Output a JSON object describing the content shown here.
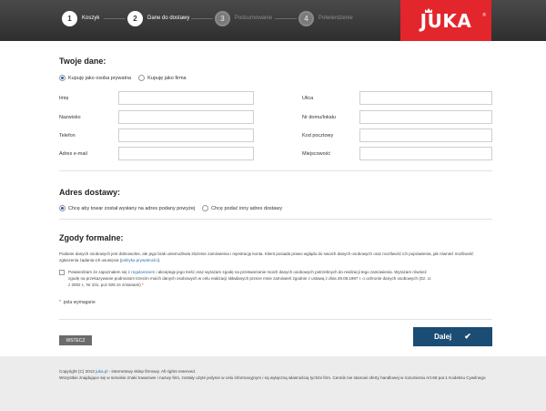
{
  "steps": [
    {
      "num": "1",
      "label": "Koszyk"
    },
    {
      "num": "2",
      "label": "Dane do dostawy"
    },
    {
      "num": "3",
      "label": "Podsumowanie"
    },
    {
      "num": "4",
      "label": "Potwierdzenie"
    }
  ],
  "logo": {
    "text": "JUKA",
    "reg": "®"
  },
  "personal": {
    "title": "Twoje dane:",
    "radio_private": "Kupuję jako osoba prywatna",
    "radio_company": "Kupuję jako firma",
    "fields_left": [
      "Imię",
      "Nazwisko",
      "Telefon",
      "Adres e-mail"
    ],
    "fields_right": [
      "Ulica",
      "Nr domu/lokalu",
      "Kod pocztowy",
      "Miejscowość"
    ]
  },
  "delivery": {
    "title": "Adres dostawy:",
    "radio_same": "Chcę aby towar został wysłany na adres podany powyżej",
    "radio_other": "Chcę podać inny adres dostawy"
  },
  "consents": {
    "title": "Zgody formalne:",
    "intro": "Podanie danych osobowych jest dobrowolne, ale jego brak uniemożliwia złożenie zamówienia i rejestrację konta. Klient posiada prawo wglądu do swoich danych osobowych oraz możliwość ich poprawienia, jak również możliwość zgłoszenia żądania ich usunięcia (",
    "intro_link": "polityka prywatności",
    "intro_end": ").",
    "check_text_1": "Potwierdzam że zapoznałem się z ",
    "check_link": "regulaminem",
    "check_text_2": " i akceptuję jego treść oraz wyrażam zgodę na przetwarzanie moich danych osobowych potrzebnych do realizacji tego zamówienia. Wyrażam również zgodę na przekazywanie podmiotom trzecim moich danych osobowych w celu realizacji składanych przeze mnie zamówień zgodnie z ustawą z dnia 29.08.1997 r. o ochronie danych osobowych (Dz. U. z 2002 r., Nr 101, poz 926 ze zmianami) ",
    "required_mark": "*",
    "required_note": "pola wymagane"
  },
  "buttons": {
    "back": "WSTECZ",
    "next": "Dalej",
    "next_icon": "✔"
  },
  "footer": {
    "line1_prefix": "Copyright (C) 2013 ",
    "line1_link": "juka.pl",
    "line1_suffix": " - internetowy sklep firmowy. All rights reserved.",
    "line2": "Wszystkie znajdujące się w serwisie znaki towarowe i nazwy firm, zostały użyte jedynie w celu informacyjnym i są wyłączną własnością tychże firm. Cennik nie stanowi oferty handlowej w rozumieniu Art.66 par.1 Kodeksu Cywilnego"
  },
  "colors": {
    "brand_red": "#e3252c",
    "button_blue": "#1b4c74",
    "link": "#2a6fb8"
  }
}
